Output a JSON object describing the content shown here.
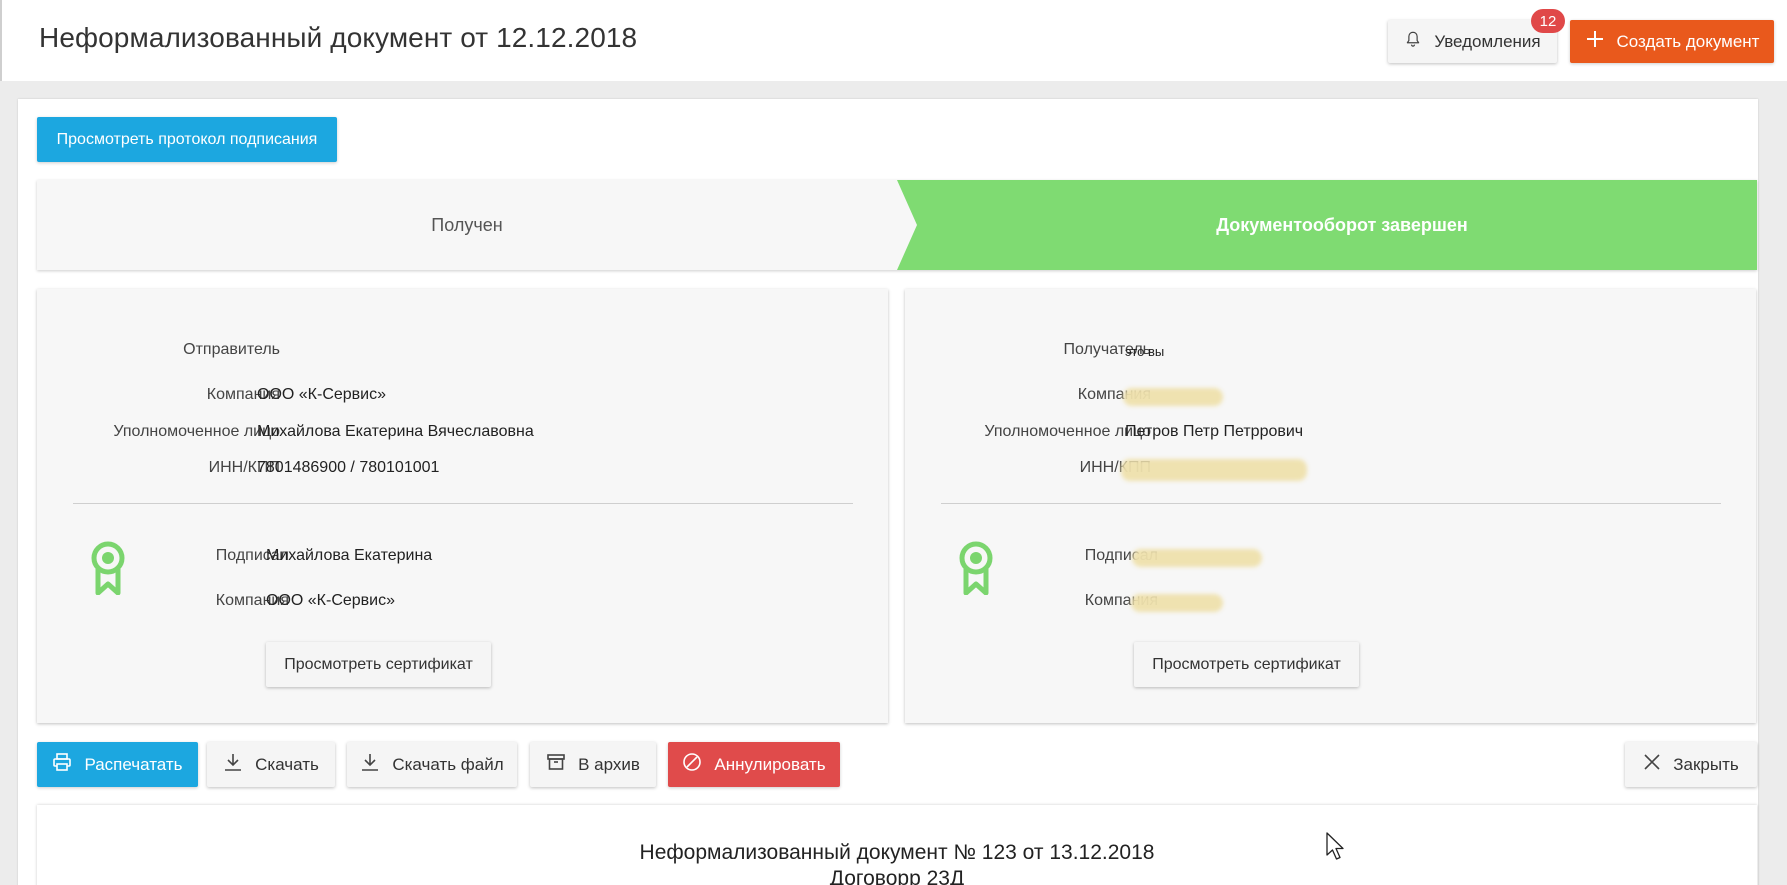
{
  "header": {
    "title": "Неформализованный документ от 12.12.2018",
    "notifications_label": "Уведомления",
    "notifications_count": "12",
    "create_label": "Создать документ"
  },
  "protocol_button": "Просмотреть протокол подписания",
  "steps": [
    {
      "label": "Получен",
      "state": "inactive"
    },
    {
      "label": "Документооборот завершен",
      "state": "done"
    }
  ],
  "sender": {
    "heading_label": "Отправитель",
    "company_label": "Компания",
    "company": "ООО «К-Сервис»",
    "authorized_label": "Уполномоченное лицо",
    "authorized": "Михайлова Екатерина Вячеславовна",
    "inn_label": "ИНН/КПП",
    "inn": "7801486900 / 780101001",
    "signed_label": "Подписал",
    "signed": "Михайлова Екатерина",
    "sign_company_label": "Компания",
    "sign_company": "ООО «К-Сервис»",
    "cert_button": "Просмотреть сертификат"
  },
  "recipient": {
    "heading_label": "Получатель",
    "heading_note": "это вы",
    "company_label": "Компания",
    "authorized_label": "Уполномоченное лицо",
    "authorized": "Петров Петр Петррович",
    "inn_label": "ИНН/КПП",
    "signed_label": "Подписал",
    "sign_company_label": "Компания",
    "cert_button": "Просмотреть сертификат"
  },
  "actions": {
    "print": "Распечатать",
    "download": "Скачать",
    "download_file": "Скачать файл",
    "archive": "В архив",
    "annul": "Аннулировать",
    "close": "Закрыть"
  },
  "document_preview": {
    "line1": "Неформализованный документ № 123 от 13.12.2018",
    "line2": "Договорр 23Д"
  },
  "colors": {
    "accent_blue": "#1ca7e0",
    "create_orange": "#e9591c",
    "annul_red": "#e04b4b",
    "step_done_green": "#7fdb72",
    "badge_red": "#e04848",
    "seal_green": "#7bd56e"
  }
}
